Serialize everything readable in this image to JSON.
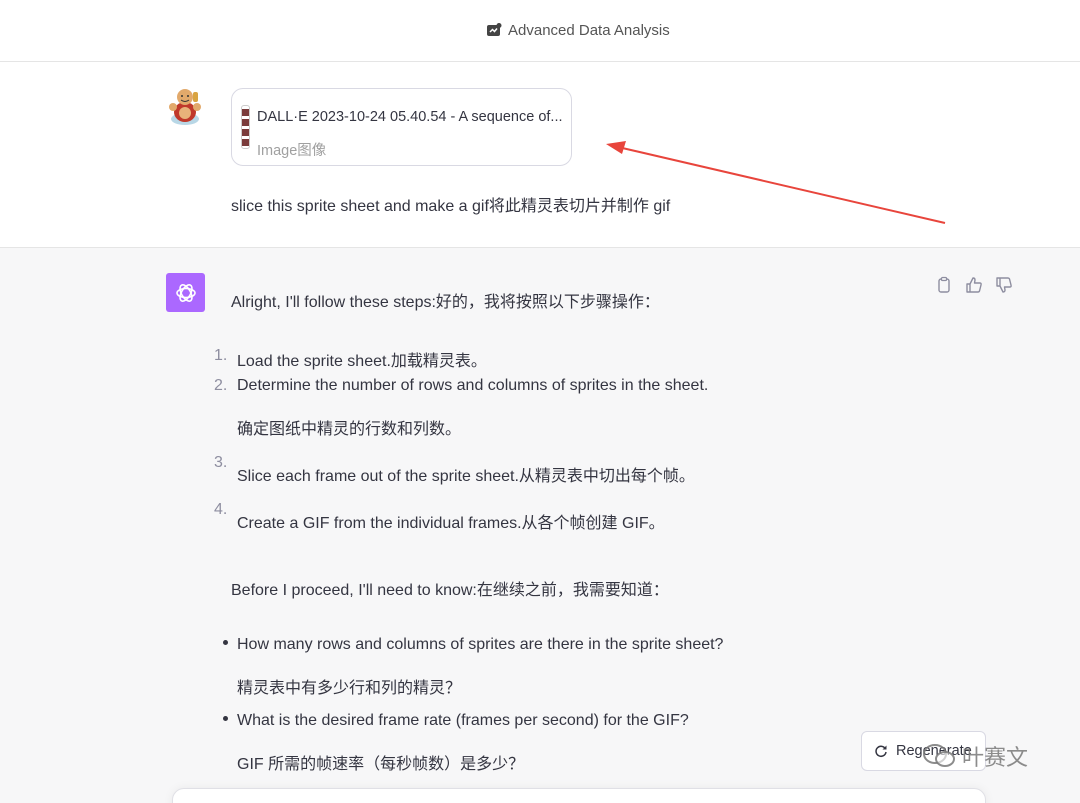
{
  "header": {
    "model_label": "Advanced Data Analysis"
  },
  "user_message": {
    "attachment": {
      "file_name": "DALL·E 2023-10-24 05.40.54 - A sequence of...",
      "file_type": "Image图像"
    },
    "text": "slice this sprite sheet and make a gif将此精灵表切片并制作 gif"
  },
  "assistant_message": {
    "intro": "Alright, I'll follow these steps:好的，我将按照以下步骤操作：",
    "steps": [
      {
        "number": "1.",
        "text": "Load the sprite sheet.加载精灵表。",
        "translation": ""
      },
      {
        "number": "2.",
        "text": "Determine the number of rows and columns of sprites in the sheet.",
        "translation": "确定图纸中精灵的行数和列数。"
      },
      {
        "number": "3.",
        "text": "Slice each frame out of the sprite sheet.从精灵表中切出每个帧。",
        "translation": ""
      },
      {
        "number": "4.",
        "text": "Create a GIF from the individual frames.从各个帧创建 GIF。",
        "translation": ""
      }
    ],
    "before": "Before I proceed, I'll need to know:在继续之前，我需要知道：",
    "questions": [
      {
        "text": "How many rows and columns of sprites are there in the sprite sheet?",
        "translation": "精灵表中有多少行和列的精灵？"
      },
      {
        "text": "What is the desired frame rate (frames per second) for the GIF?",
        "translation": "GIF 所需的帧速率（每秒帧数）是多少？"
      }
    ]
  },
  "regenerate": {
    "label": "Regenerate"
  },
  "watermark": {
    "text": "叶赛文"
  },
  "colors": {
    "assistant_avatar": "#ab68ff",
    "arrow": "#e8453c",
    "assistant_bg": "#f7f7f8"
  }
}
